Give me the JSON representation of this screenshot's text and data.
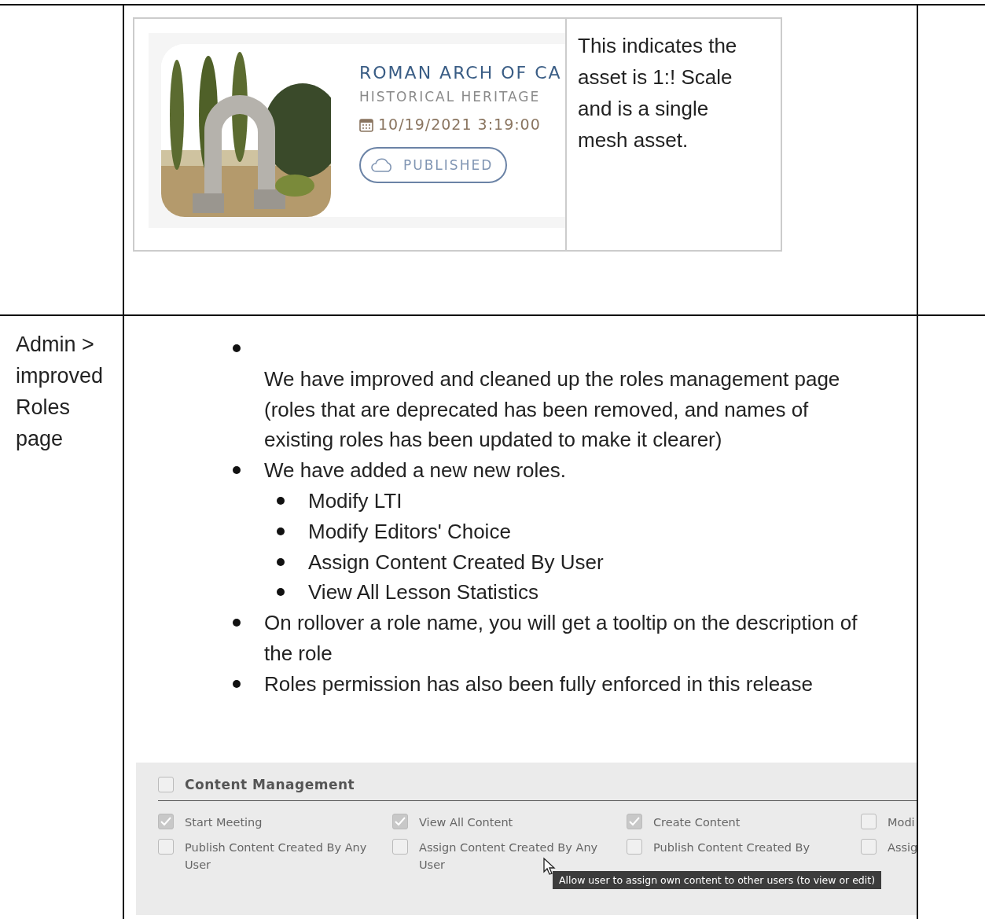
{
  "row_1": {
    "asset_card": {
      "title": "ROMAN ARCH OF CA",
      "category": "HISTORICAL HERITAGE",
      "date": "10/19/2021 3:19:00",
      "status": "PUBLISHED"
    },
    "note": "This indicates the asset is 1:! Scale and is a single mesh asset."
  },
  "row_2": {
    "heading": "Admin > improved Roles page",
    "bullets": [
      {
        "text": "We have improved and cleaned up the roles management page (roles that are deprecated has been removed, and names of existing roles has been updated to make it clearer)",
        "break_before": true
      },
      {
        "text": "We have added a new new roles.",
        "break_before": false,
        "children": [
          {
            "text": "Modify LTI"
          },
          {
            "text": "Modify Editors' Choice"
          },
          {
            "text": "Assign Content Created By User"
          },
          {
            "text": "View All Lesson Statistics"
          }
        ]
      },
      {
        "text": "On rollover a role name, you will get a tooltip on the description of the role",
        "break_before": false
      },
      {
        "text": "Roles permission has also been fully enforced in this release",
        "break_before": false
      }
    ],
    "roles_panel": {
      "group": {
        "label": "Content Management",
        "checked": false
      },
      "permissions": [
        {
          "label": "Start Meeting",
          "checked": true
        },
        {
          "label": "View All Content",
          "checked": true
        },
        {
          "label": "Create Content",
          "checked": true
        },
        {
          "label": "Modi",
          "checked": false
        },
        {
          "label": "Publish Content Created By Any User",
          "checked": false
        },
        {
          "label": "Assign Content Created By Any User",
          "checked": false
        },
        {
          "label": "Publish Content Created By",
          "checked": false
        },
        {
          "label": "Assig",
          "checked": false
        }
      ],
      "tooltip": "Allow user to assign own content to other users (to view or edit)"
    }
  }
}
